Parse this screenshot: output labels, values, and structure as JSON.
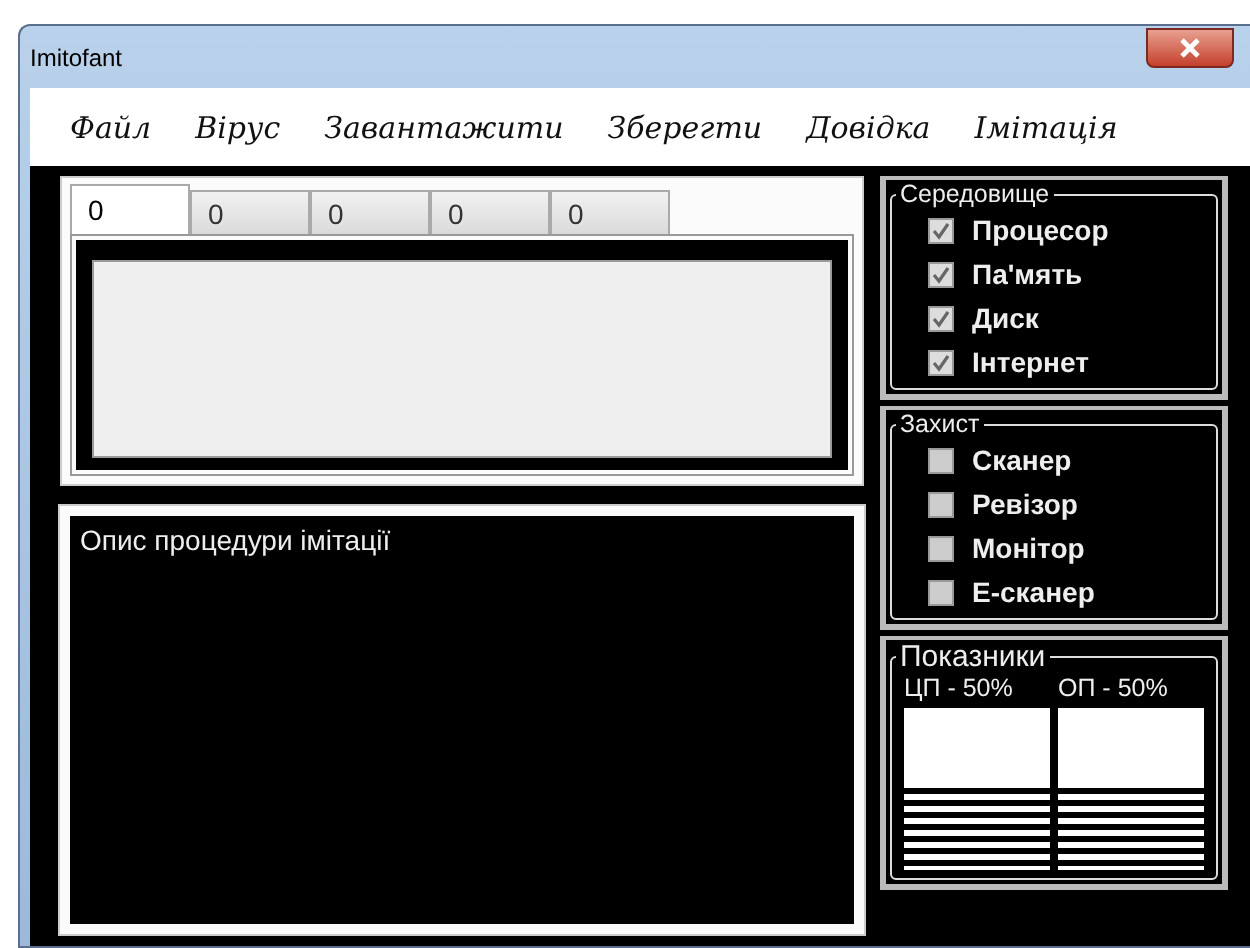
{
  "window": {
    "title": "Imitofant"
  },
  "menu": [
    "Файл",
    "Вірус",
    "Завантажити",
    "Зберегти",
    "Довідка",
    "Імітація"
  ],
  "tabs": [
    {
      "label": "0",
      "selected": true
    },
    {
      "label": "0",
      "selected": false
    },
    {
      "label": "0",
      "selected": false
    },
    {
      "label": "0",
      "selected": false
    },
    {
      "label": "0",
      "selected": false
    }
  ],
  "description": {
    "text": "Опис процедури імітації"
  },
  "groups": [
    {
      "title": "Середовище",
      "items": [
        {
          "label": "Процесор",
          "checked": true
        },
        {
          "label": "Па'мять",
          "checked": true
        },
        {
          "label": "Диск",
          "checked": true
        },
        {
          "label": "Інтернет",
          "checked": true
        }
      ]
    },
    {
      "title": "Захист",
      "items": [
        {
          "label": "Сканер",
          "checked": false
        },
        {
          "label": "Ревізор",
          "checked": false
        },
        {
          "label": "Монітор",
          "checked": false
        },
        {
          "label": "Е-сканер",
          "checked": false
        }
      ]
    }
  ],
  "indicators": {
    "title": "Показники",
    "meters": [
      {
        "label": "ЦП - 50%",
        "level": 0.5
      },
      {
        "label": "ОП - 50%",
        "level": 0.5
      }
    ]
  }
}
